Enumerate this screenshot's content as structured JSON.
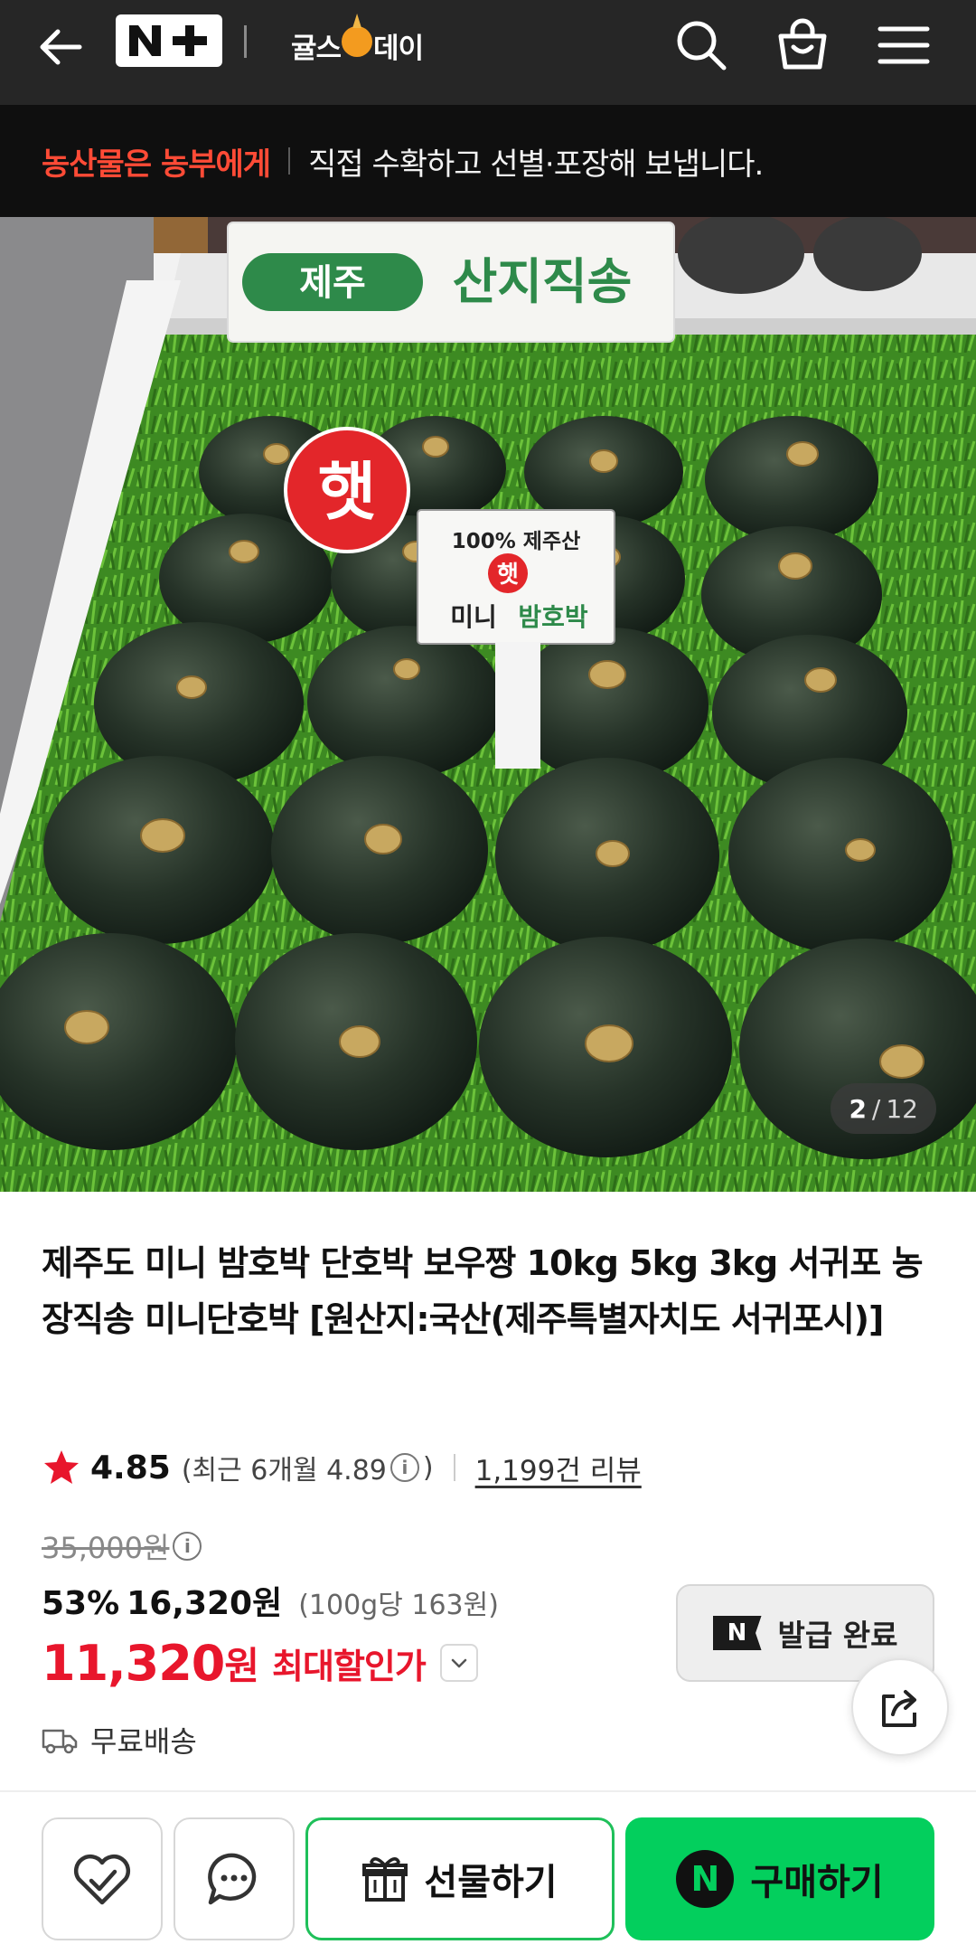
{
  "header": {
    "back_icon": "arrow-left-icon",
    "store_badge": "N+",
    "brand_left": "귤스",
    "brand_right": "데이",
    "search_icon": "search-icon",
    "cart_icon": "shopping-bag-icon",
    "menu_icon": "hamburger-menu-icon"
  },
  "notice": {
    "accent": "농산물은 농부에게",
    "message": "직접 수확하고 선별·포장해 보냅니다."
  },
  "gallery": {
    "current": "2",
    "total": "12",
    "sign_main_left": "제주",
    "sign_main_right": "산지직송",
    "sign_small_line1": "100% 제주산",
    "sign_small_badge": "햇",
    "sign_small_line2a": "미니",
    "sign_small_line2b": "밤호박",
    "round_tag": "햇"
  },
  "product": {
    "title": "제주도 미니 밤호박 단호박 보우짱 10kg 5kg 3kg 서귀포 농장직송 미니단호박 [원산지:국산(제주특별자치도 서귀포시)]",
    "rating": "4.85",
    "rating_recent": "(최근 6개월 4.89",
    "rating_recent_close": ")",
    "reviews": "1,199건 리뷰",
    "original_price": "35,000원",
    "discount_pct": "53%",
    "discount_price": "16,320원",
    "unit_price": "(100g당 163원)",
    "final_price": "11,320",
    "final_currency": "원",
    "final_label": "최대할인가",
    "coupon_label": "발급 완료",
    "coupon_mark": "N",
    "shipping": "무료배송"
  },
  "bottom_bar": {
    "like_icon": "heart-check-icon",
    "talk_icon": "chat-bubble-icon",
    "gift_label": "선물하기",
    "buy_label": "구매하기",
    "buy_mark": "N"
  },
  "colors": {
    "accent_red": "#e8162c",
    "notice_red": "#ff4b36",
    "naver_green": "#03cf5d",
    "header_bg": "#262626"
  }
}
